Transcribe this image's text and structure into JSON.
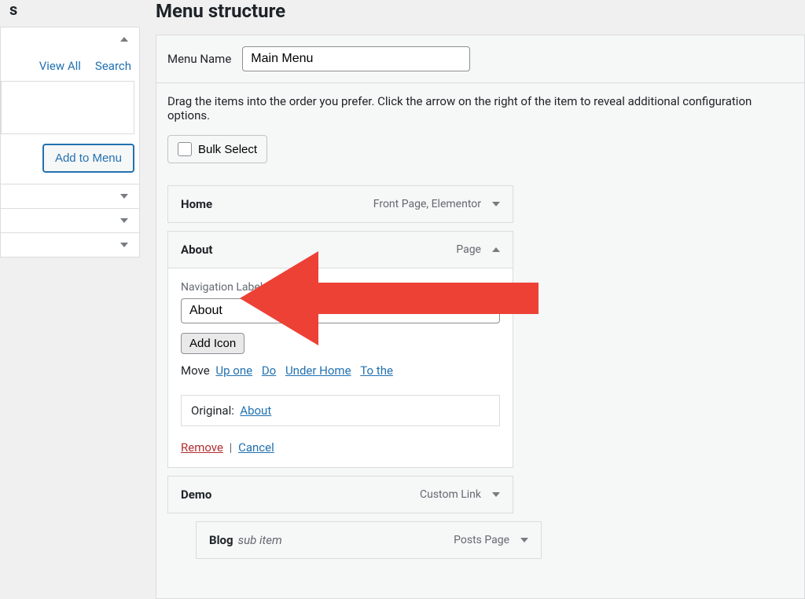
{
  "sidebar": {
    "heading_suffix": "s",
    "tabs": {
      "view_all": "View All",
      "search": "Search"
    },
    "add_to_menu": "Add to Menu"
  },
  "main": {
    "title": "Menu structure",
    "menu_name_label": "Menu Name",
    "menu_name_value": "Main Menu",
    "instructions": "Drag the items into the order you prefer. Click the arrow on the right of the item to reveal additional configuration options.",
    "bulk_select": "Bulk Select"
  },
  "item_home": {
    "title": "Home",
    "type": "Front Page, Elementor"
  },
  "item_about": {
    "title": "About",
    "type": "Page",
    "nav_label_heading": "Navigation Label",
    "nav_label_value": "About",
    "add_icon": "Add Icon",
    "move_label": "Move",
    "move_up": "Up one",
    "move_down_partial": "Do",
    "move_under_partial": "Under Home",
    "move_top_partial": "To the",
    "original_label": "Original:",
    "original_link": "About",
    "remove": "Remove",
    "cancel": "Cancel"
  },
  "item_demo": {
    "title": "Demo",
    "type": "Custom Link"
  },
  "item_blog": {
    "title": "Blog",
    "sub": "sub item",
    "type": "Posts Page"
  }
}
